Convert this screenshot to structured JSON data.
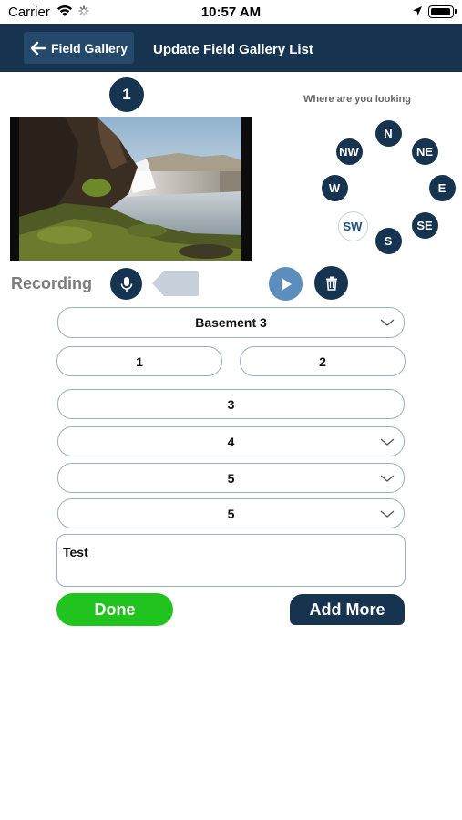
{
  "status_bar": {
    "carrier": "Carrier",
    "time": "10:57 AM",
    "icons": [
      "wifi-icon",
      "activity-spinner-icon",
      "location-arrow-icon",
      "battery-icon"
    ]
  },
  "nav": {
    "back_label": "Field Gallery",
    "title": "Update Field Gallery List",
    "background": "#16344f"
  },
  "photo": {
    "index": "1"
  },
  "compass": {
    "title": "Where are you looking",
    "directions": [
      "N",
      "NE",
      "E",
      "SE",
      "S",
      "SW",
      "W",
      "NW"
    ],
    "selected": "SW"
  },
  "recording": {
    "label": "Recording",
    "icons": [
      "microphone-icon",
      "audio-tag-icon",
      "play-icon",
      "trash-icon"
    ]
  },
  "form": {
    "location": "Basement 3",
    "field_1": "1",
    "field_2": "2",
    "field_3": "3",
    "select_4": "4",
    "select_5a": "5",
    "select_5b": "5",
    "notes": "Test"
  },
  "actions": {
    "done_label": "Done",
    "add_more_label": "Add More",
    "done_color": "#21c41e"
  }
}
